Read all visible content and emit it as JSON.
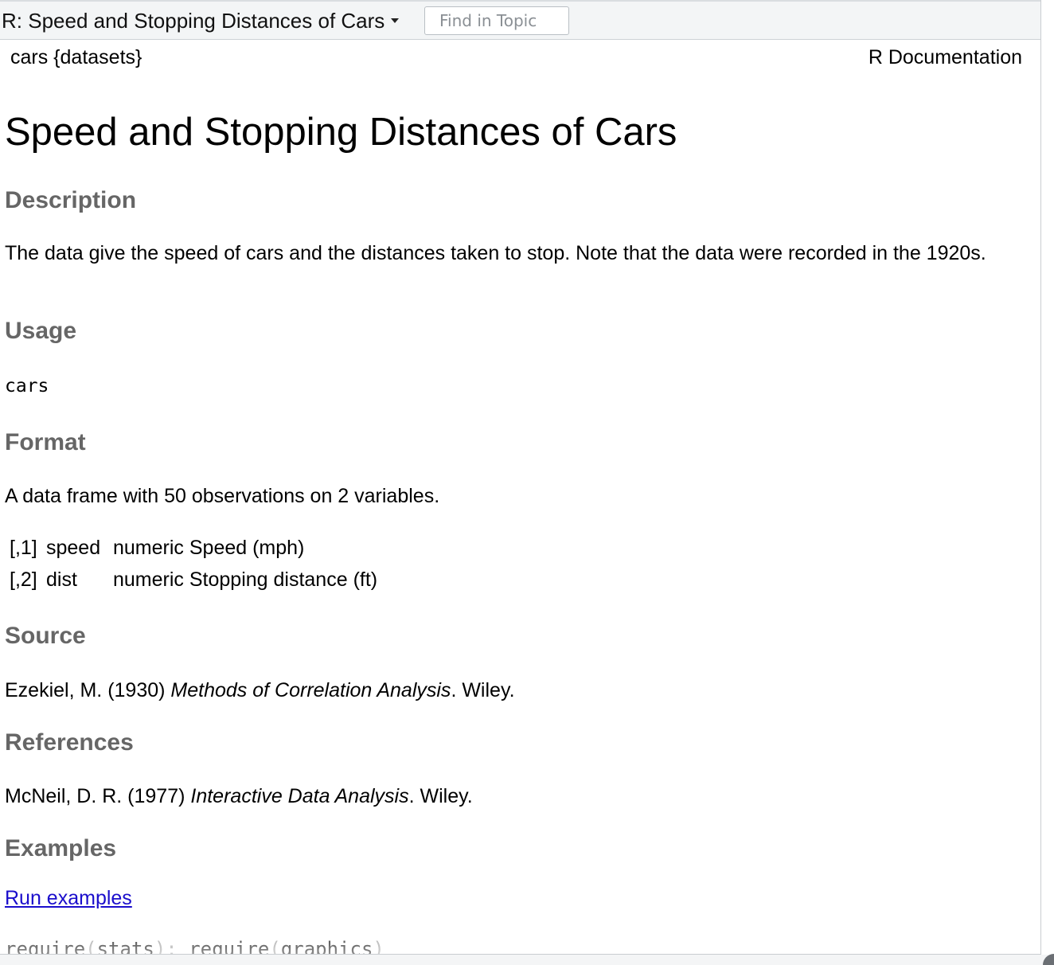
{
  "toolbar": {
    "topic_title": "R: Speed and Stopping Distances of Cars",
    "find_placeholder": "Find in Topic"
  },
  "header": {
    "left": "cars {datasets}",
    "right": "R Documentation"
  },
  "page_title": "Speed and Stopping Distances of Cars",
  "sections": {
    "description": {
      "heading": "Description",
      "text": "The data give the speed of cars and the distances taken to stop. Note that the data were recorded in the 1920s."
    },
    "usage": {
      "heading": "Usage",
      "code": "cars"
    },
    "format": {
      "heading": "Format",
      "text": "A data frame with 50 observations on 2 variables.",
      "rows": [
        {
          "index": "[,1]",
          "name": "speed",
          "desc": "numeric Speed (mph)"
        },
        {
          "index": "[,2]",
          "name": "dist",
          "desc": "numeric Stopping distance (ft)"
        }
      ]
    },
    "source": {
      "heading": "Source",
      "prefix": "Ezekiel, M. (1930) ",
      "title": "Methods of Correlation Analysis",
      "suffix": ". Wiley."
    },
    "references": {
      "heading": "References",
      "prefix": "McNeil, D. R. (1977) ",
      "title": "Interactive Data Analysis",
      "suffix": ". Wiley."
    },
    "examples": {
      "heading": "Examples",
      "link": "Run examples",
      "code_a": "require",
      "code_b": "(",
      "code_c": "stats",
      "code_d": "); ",
      "code_e": "require",
      "code_f": "(",
      "code_g": "graphics",
      "code_h": ")"
    }
  }
}
